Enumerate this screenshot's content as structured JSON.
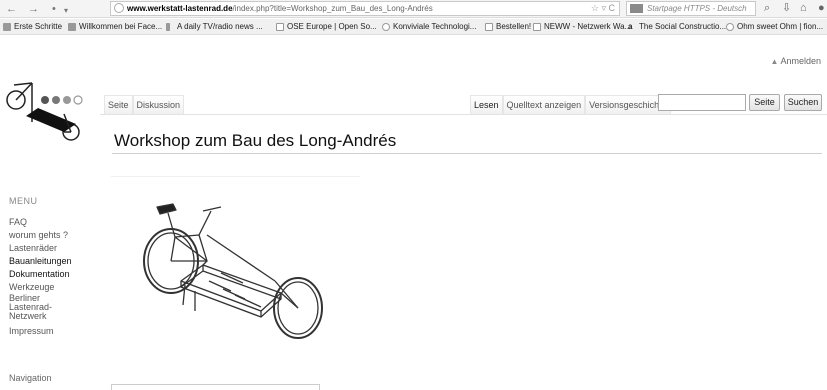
{
  "browser": {
    "back": "←",
    "forward": "→",
    "home_like": "•",
    "url_host": "www.werkstatt-lastenrad.de",
    "url_rest": "/index.php?title=Workshop_zum_Bau_des_Long-Andrés",
    "url_right_icons": "☆ ▿ C",
    "search_placeholder": "Startpage HTTPS - Deutsch",
    "search_icon": "⌕",
    "download_icon": "⇩",
    "home_icon": "⌂"
  },
  "bookmarks": [
    {
      "label": "Erste Schritte",
      "icon": "firefox-icon"
    },
    {
      "label": "Willkommen bei Face...",
      "icon": "facebook-icon"
    },
    {
      "label": "A daily TV/radio news ...",
      "icon": "news-icon"
    },
    {
      "label": "OSE Europe | Open So...",
      "icon": "page-icon"
    },
    {
      "label": "Konviviale Technologi...",
      "icon": "page-icon"
    },
    {
      "label": "Bestellen!",
      "icon": "page-icon"
    },
    {
      "label": "NEWW - Netzwerk Wa...",
      "icon": "page-icon"
    },
    {
      "label": "The Social Constructio...",
      "icon": "amazon-icon"
    },
    {
      "label": "Ohm sweet Ohm | fion...",
      "icon": "wp-icon"
    }
  ],
  "wiki": {
    "login": "Anmelden",
    "tabs_left": [
      "Seite",
      "Diskussion"
    ],
    "tabs_right": [
      "Lesen",
      "Quelltext anzeigen",
      "Versionsgeschichte"
    ],
    "search_value": "",
    "btn_page": "Seite",
    "btn_search": "Suchen",
    "title": "Workshop zum Bau des Long-Andrés"
  },
  "sidebar": {
    "heading": "MENU",
    "items": [
      {
        "label": "FAQ",
        "dark": false
      },
      {
        "label": "worum gehts ?",
        "dark": false
      },
      {
        "label": "Lastenräder",
        "dark": false
      },
      {
        "label": "Bauanleitungen",
        "dark": true
      },
      {
        "label": "Dokumentation",
        "dark": true
      },
      {
        "label": "Werkzeuge",
        "dark": false
      },
      {
        "label": "Berliner Lastenrad-Netzwerk",
        "dark": false
      },
      {
        "label": "Impressum",
        "dark": false
      }
    ],
    "nav_heading": "Navigation"
  },
  "colors": {
    "accent": "#333333",
    "chrome": "#f4f4f4"
  }
}
